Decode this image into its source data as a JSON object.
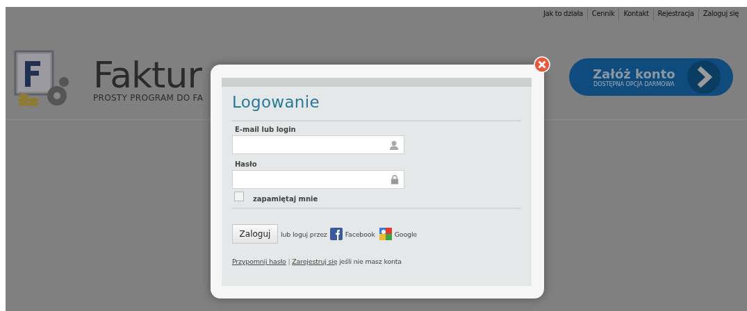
{
  "nav": [
    {
      "label": "Jak to działa"
    },
    {
      "label": "Cennik"
    },
    {
      "label": "Kontakt"
    },
    {
      "label": "Rejestracja"
    },
    {
      "label": "Zaloguj się"
    }
  ],
  "brand": {
    "name": "Faktur",
    "tagline": "PROSTY PROGRAM DO FA"
  },
  "signup": {
    "label": "Załóż konto",
    "sublabel": "DOSTĘPNA OPCJA DARMOWA"
  },
  "modal": {
    "title": "Logowanie",
    "fields": [
      {
        "label": "E-mail lub login",
        "kind": "user"
      },
      {
        "label": "Hasło",
        "kind": "password"
      }
    ],
    "remember": {
      "label": "zapamiętaj mnie",
      "checked": false
    },
    "submit": "Zaloguj",
    "or_text": "lub loguj przez",
    "providers": [
      {
        "name": "Facebook",
        "kind": "facebook"
      },
      {
        "name": "Google",
        "kind": "google"
      }
    ],
    "footer": {
      "remind": "Przypomnij hasło",
      "separator": "|",
      "register": "Zarejestruj się",
      "rest": "jeśli nie masz konta"
    }
  }
}
